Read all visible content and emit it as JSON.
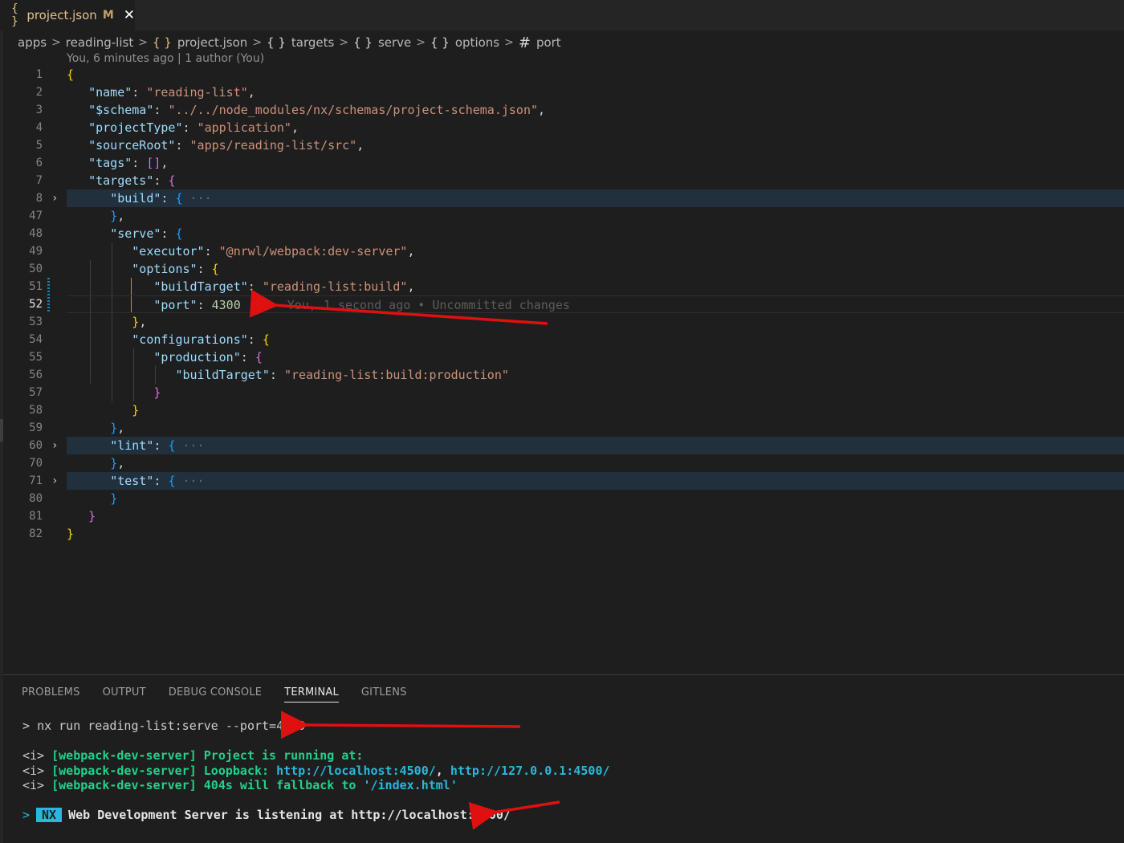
{
  "tab": {
    "icon_text": "{ }",
    "filename": "project.json",
    "modified_badge": "M"
  },
  "breadcrumb": {
    "items": [
      "apps",
      "reading-list",
      "project.json",
      "targets",
      "serve",
      "options",
      "port"
    ],
    "icon_braces": "{ }",
    "icon_hash": "#",
    "separator": ">"
  },
  "blame": {
    "text": "You, 6 minutes ago | 1 author (You)"
  },
  "editor": {
    "line_numbers": [
      "1",
      "2",
      "3",
      "4",
      "5",
      "6",
      "7",
      "8",
      "47",
      "48",
      "49",
      "50",
      "51",
      "52",
      "53",
      "54",
      "55",
      "56",
      "57",
      "58",
      "59",
      "60",
      "70",
      "71",
      "80",
      "81",
      "82"
    ],
    "inline_blame": "You, 1 second ago • Uncommitted changes",
    "fold_ellipsis": "···",
    "tokens": {
      "name_key": "\"name\"",
      "name_val": "\"reading-list\"",
      "schema_key": "\"$schema\"",
      "schema_val": "\"../../node_modules/nx/schemas/project-schema.json\"",
      "ptype_key": "\"projectType\"",
      "ptype_val": "\"application\"",
      "sroot_key": "\"sourceRoot\"",
      "sroot_val": "\"apps/reading-list/src\"",
      "tags_key": "\"tags\"",
      "targets_key": "\"targets\"",
      "build_key": "\"build\"",
      "serve_key": "\"serve\"",
      "executor_key": "\"executor\"",
      "executor_val": "\"@nrwl/webpack:dev-server\"",
      "options_key": "\"options\"",
      "buildtarget_key": "\"buildTarget\"",
      "buildtarget_val": "\"reading-list:build\"",
      "port_key": "\"port\"",
      "port_val": "4300",
      "configs_key": "\"configurations\"",
      "production_key": "\"production\"",
      "prod_bt_key": "\"buildTarget\"",
      "prod_bt_val": "\"reading-list:build:production\"",
      "lint_key": "\"lint\"",
      "test_key": "\"test\""
    }
  },
  "panel": {
    "tabs": [
      "PROBLEMS",
      "OUTPUT",
      "DEBUG CONSOLE",
      "TERMINAL",
      "GITLENS"
    ],
    "active_tab": "TERMINAL"
  },
  "terminal": {
    "command_prompt": ">",
    "command": "nx run reading-list:serve --port=4500",
    "info_prefix": "<i>",
    "server_tag": "[webpack-dev-server]",
    "line1_text": "Project is running at:",
    "line2_label": "Loopback:",
    "line2_url1": "http://localhost:4500/",
    "line2_sep": ",",
    "line2_url2": "http://127.0.0.1:4500/",
    "line3_a": "404s will fallback to",
    "line3_b": "'/index.html'",
    "nx_badge": "NX",
    "nx_message": "Web Development Server is listening at http://localhost:4500/"
  },
  "colors": {
    "background": "#1e1e1e",
    "json_key": "#9cdcfe",
    "json_string": "#ce9178",
    "json_number": "#b5cea8",
    "terminal_green": "#23d18b",
    "terminal_cyan": "#29b8db",
    "annotation_arrow": "#e01010"
  }
}
